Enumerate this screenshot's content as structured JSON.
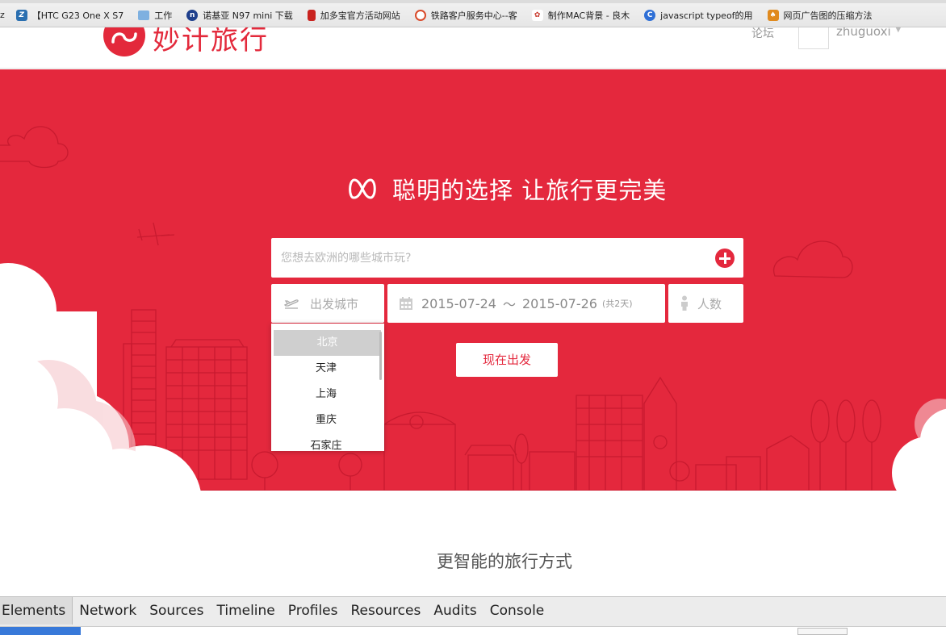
{
  "bookmarks": [
    {
      "label": "z",
      "icon": "bookmark-z-icon",
      "color": "#ffffff"
    },
    {
      "label": "【HTC G23 One X S7",
      "icon": "htc-icon",
      "color": "#2a6fb0"
    },
    {
      "label": "工作",
      "icon": "folder-icon",
      "color": "#6a9fd4"
    },
    {
      "label": "诺基亚 N97 mini 下载",
      "icon": "n-icon",
      "color": "#1e3f8c"
    },
    {
      "label": "加多宝官方活动网站",
      "icon": "jdb-icon",
      "color": "#c9231f"
    },
    {
      "label": "铁路客户服务中心--客",
      "icon": "railway-icon",
      "color": "#d94a2a"
    },
    {
      "label": "制作MAC背景 - 良木",
      "icon": "liangmu-icon",
      "color": "#c8372a"
    },
    {
      "label": "javascript typeof的用",
      "icon": "baidu-icon",
      "color": "#2e6fd6"
    },
    {
      "label": "网页广告图的压缩方法",
      "icon": "web-icon",
      "color": "#e08a1e"
    }
  ],
  "header": {
    "brand": "妙计旅行",
    "forum": "论坛",
    "username": "zhuguoxi",
    "caret": "▼",
    "brand_color": "#e3293b"
  },
  "hero": {
    "slogan": "聪明的选择 让旅行更完美",
    "search_placeholder": "您想去欧洲的哪些城市玩?",
    "depart_label": "出发城市",
    "date_start": "2015-07-24",
    "date_tilde": "～",
    "date_end": "2015-07-26",
    "date_days": "(共2天)",
    "people_label": "人数",
    "go_button": "现在出发",
    "bg_color": "#e4283d"
  },
  "city_dropdown": {
    "items": [
      "北京",
      "天津",
      "上海",
      "重庆",
      "石家庄"
    ],
    "selected_index": 0
  },
  "section": {
    "title": "更智能的旅行方式"
  },
  "devtools": {
    "tabs": [
      "Elements",
      "Network",
      "Sources",
      "Timeline",
      "Profiles",
      "Resources",
      "Audits",
      "Console"
    ],
    "active_tab": "Elements"
  }
}
